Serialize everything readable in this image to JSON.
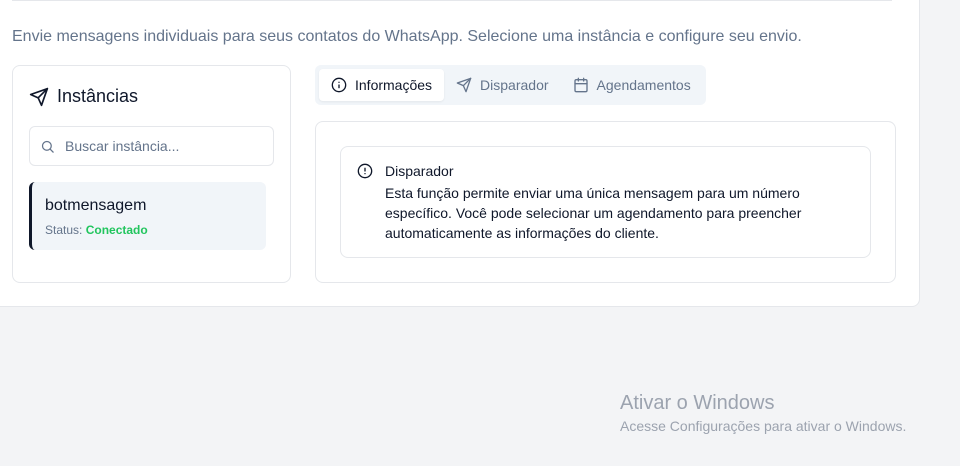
{
  "description": "Envie mensagens individuais para seus contatos do WhatsApp. Selecione uma instância e configure seu envio.",
  "instances": {
    "title": "Instâncias",
    "title_icon": "send-icon",
    "search": {
      "placeholder": "Buscar instância...",
      "value": ""
    },
    "items": [
      {
        "name": "botmensagem",
        "status_label": "Status:",
        "status": "Conectado"
      }
    ]
  },
  "tabs": [
    {
      "label": "Informações",
      "icon": "info-icon",
      "active": true
    },
    {
      "label": "Disparador",
      "icon": "send-icon",
      "active": false
    },
    {
      "label": "Agendamentos",
      "icon": "calendar-icon",
      "active": false
    }
  ],
  "info_alert": {
    "icon": "info-icon",
    "title": "Disparador",
    "body": "Esta função permite enviar uma única mensagem para um número específico. Você pode selecionar um agendamento para preencher automaticamente as informações do cliente."
  },
  "watermark": {
    "title": "Ativar o Windows",
    "subtitle": "Acesse Configurações para ativar o Windows."
  },
  "colors": {
    "accent": "#0f172a",
    "muted": "#64748b",
    "status_ok": "#22c55e",
    "border": "#e5e7eb"
  }
}
